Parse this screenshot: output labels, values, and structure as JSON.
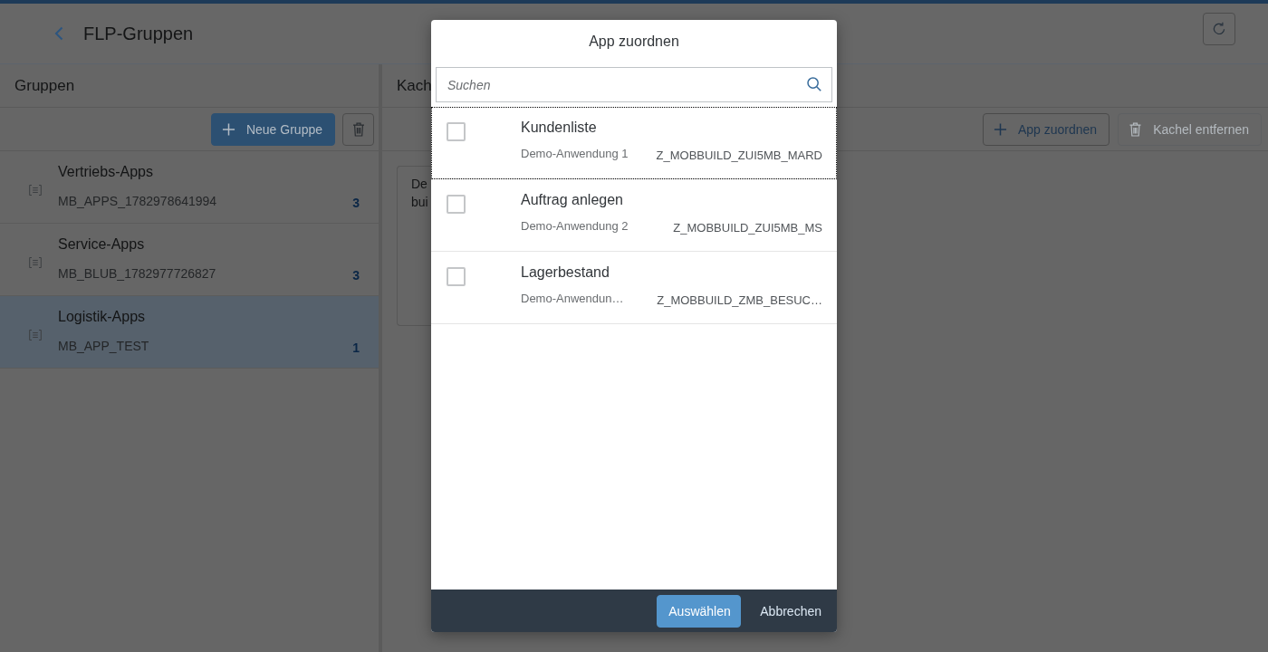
{
  "header": {
    "title": "FLP-Gruppen"
  },
  "groups_panel": {
    "title": "Gruppen",
    "toolbar": [
      {
        "kind": "add",
        "label": "Neue Gruppe",
        "emphasized": true
      },
      {
        "kind": "delete",
        "emphasized": false
      }
    ],
    "items": [
      {
        "title": "Vertriebs-Apps",
        "subtitle": "MB_APPS_1782978641994",
        "count": "3",
        "selected": false
      },
      {
        "title": "Service-Apps",
        "subtitle": "MB_BLUB_1782977726827",
        "count": "3",
        "selected": false
      },
      {
        "title": "Logistik-Apps",
        "subtitle": "MB_APP_TEST",
        "count": "1",
        "selected": true
      }
    ]
  },
  "tiles_panel": {
    "title": "Kach",
    "toolbar": [
      {
        "kind": "add",
        "label": "App zuordnen",
        "disabled": false
      },
      {
        "kind": "delete",
        "label": "Kachel entfernen",
        "disabled": true
      }
    ],
    "tile": {
      "lines": [
        "De",
        "bui"
      ]
    }
  },
  "dialog": {
    "title": "App zuordnen",
    "search": {
      "placeholder": "Suchen"
    },
    "items": [
      {
        "title": "Kundenliste",
        "description": "Demo-Anwendung 1",
        "info": "Z_MOBBUILD_ZUI5MB_MARD",
        "checked": false,
        "focused": true
      },
      {
        "title": "Auftrag anlegen",
        "description": "Demo-Anwendung 2",
        "info": "Z_MOBBUILD_ZUI5MB_MS",
        "checked": false,
        "focused": false
      },
      {
        "title": "Lagerbestand",
        "description": "Demo-Anwendun…",
        "info": "Z_MOBBUILD_ZMB_BESUC…",
        "checked": false,
        "focused": false
      }
    ],
    "buttons": [
      {
        "label": "Auswählen",
        "emphasized": true
      },
      {
        "label": "Abbrechen",
        "emphasized": false
      }
    ]
  }
}
